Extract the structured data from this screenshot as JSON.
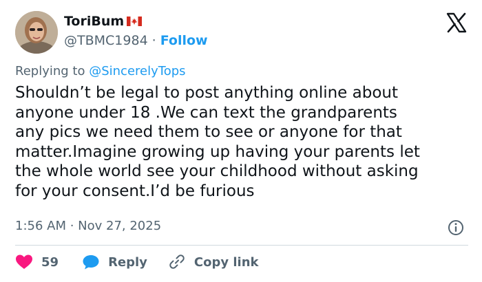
{
  "author": {
    "display_name": "ToriBum",
    "flag": "canada-flag",
    "handle": "@TBMC1984",
    "separator": "·",
    "follow_label": "Follow"
  },
  "reply_context": {
    "prefix": "Replying to",
    "mention": "@SincerelyTops"
  },
  "tweet": {
    "lines": [
      "Shouldn’t be legal to post anything online about",
      "anyone under 18 .We can text the grandparents",
      "any pics we need them to see or anyone for that",
      "matter.Imagine growing up having your parents let",
      "the whole world see your childhood without asking",
      "for your consent.I’d be furious"
    ],
    "timestamp": "1:56 AM · Nov 27, 2025"
  },
  "actions": {
    "like_count": "59",
    "reply_label": "Reply",
    "copy_link_label": "Copy link"
  },
  "colors": {
    "accent": "#1d9bf0",
    "like": "#f91880",
    "muted": "#536471",
    "text": "#0f1419"
  },
  "icons": [
    "x-logo-icon",
    "canada-flag-icon",
    "info-icon",
    "heart-icon",
    "reply-bubble-icon",
    "link-icon"
  ]
}
